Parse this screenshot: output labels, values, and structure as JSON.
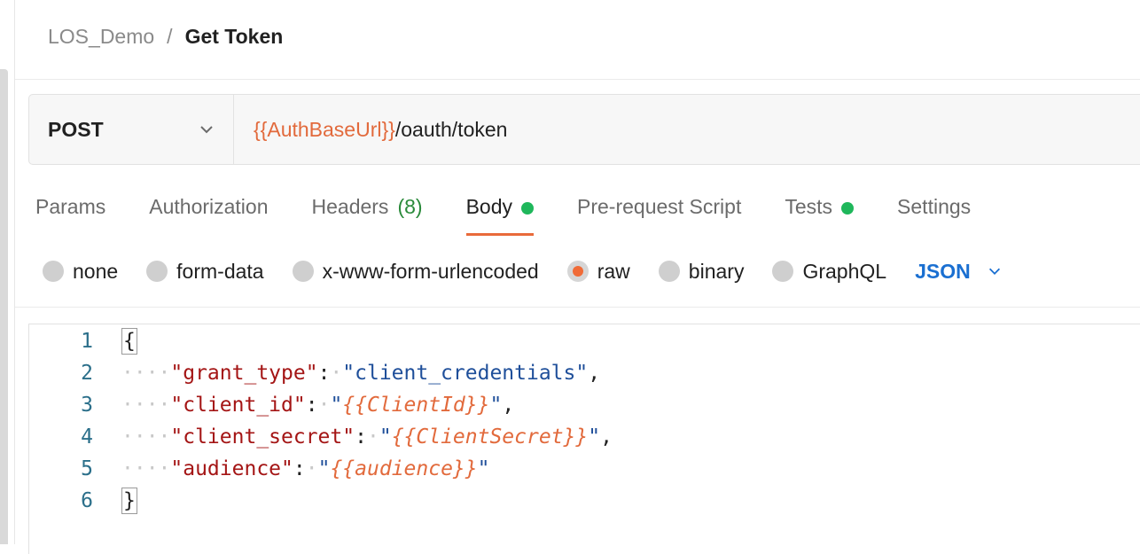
{
  "breadcrumb": {
    "parent": "LOS_Demo",
    "separator": "/",
    "current": "Get Token"
  },
  "request": {
    "method": "POST",
    "url_variable": "{{AuthBaseUrl}}",
    "url_path": "/oauth/token"
  },
  "tabs": {
    "params": "Params",
    "authorization": "Authorization",
    "headers": "Headers",
    "headers_count": "(8)",
    "body": "Body",
    "prerequest": "Pre-request Script",
    "tests": "Tests",
    "settings": "Settings",
    "active": "Body"
  },
  "body_options": {
    "none": "none",
    "form_data": "form-data",
    "urlencoded": "x-www-form-urlencoded",
    "raw": "raw",
    "binary": "binary",
    "graphql": "GraphQL",
    "selected": "raw",
    "format": "JSON"
  },
  "editor": {
    "line_numbers": [
      "1",
      "2",
      "3",
      "4",
      "5",
      "6"
    ],
    "open_brace": "{",
    "close_brace": "}",
    "indent": "····",
    "colon": ":",
    "pairs": [
      {
        "key": "\"grant_type\"",
        "value": "\"client_credentials\"",
        "comma": ","
      },
      {
        "key": "\"client_id\"",
        "quote": "\"",
        "var": "{{ClientId}}",
        "comma": ","
      },
      {
        "key": "\"client_secret\"",
        "quote": "\"",
        "var": "{{ClientSecret}}",
        "comma": ","
      },
      {
        "key": "\"audience\"",
        "quote": "\"",
        "var": "{{audience}}",
        "comma": ""
      }
    ]
  },
  "colors": {
    "accent": "#e96a3a",
    "variable": "#e26a3c",
    "link": "#1a6fd1",
    "success": "#1fb75b"
  }
}
